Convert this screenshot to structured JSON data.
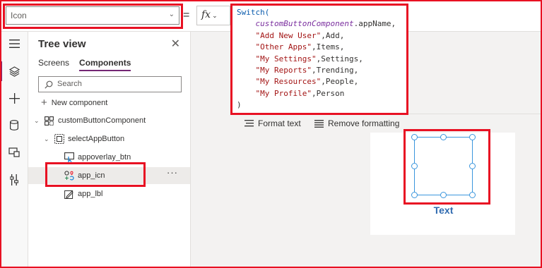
{
  "formula_bar": {
    "property": "Icon",
    "equals": "=",
    "fx": "fx",
    "formula_lines": [
      {
        "parts": [
          {
            "t": "Switch(",
            "c": "kw"
          }
        ]
      },
      {
        "parts": [
          {
            "t": "    ",
            "c": ""
          },
          {
            "t": "customButtonComponent",
            "c": "it"
          },
          {
            "t": ".appName,",
            "c": ""
          }
        ]
      },
      {
        "parts": [
          {
            "t": "    ",
            "c": ""
          },
          {
            "t": "\"Add New User\"",
            "c": "str"
          },
          {
            "t": ",Add,",
            "c": ""
          }
        ]
      },
      {
        "parts": [
          {
            "t": "    ",
            "c": ""
          },
          {
            "t": "\"Other Apps\"",
            "c": "str"
          },
          {
            "t": ",Items,",
            "c": ""
          }
        ]
      },
      {
        "parts": [
          {
            "t": "    ",
            "c": ""
          },
          {
            "t": "\"My Settings\"",
            "c": "str"
          },
          {
            "t": ",Settings,",
            "c": ""
          }
        ]
      },
      {
        "parts": [
          {
            "t": "    ",
            "c": ""
          },
          {
            "t": "\"My Reports\"",
            "c": "str"
          },
          {
            "t": ",Trending,",
            "c": ""
          }
        ]
      },
      {
        "parts": [
          {
            "t": "    ",
            "c": ""
          },
          {
            "t": "\"My Resources\"",
            "c": "str"
          },
          {
            "t": ",People,",
            "c": ""
          }
        ]
      },
      {
        "parts": [
          {
            "t": "    ",
            "c": ""
          },
          {
            "t": "\"My Profile\"",
            "c": "str"
          },
          {
            "t": ",Person",
            "c": ""
          }
        ]
      },
      {
        "parts": [
          {
            "t": ")",
            "c": ""
          }
        ]
      }
    ],
    "format_text": "Format text",
    "remove_formatting": "Remove formatting"
  },
  "tree_view": {
    "title": "Tree view",
    "tabs": [
      "Screens",
      "Components"
    ],
    "active_tab": "Components",
    "search_placeholder": "Search",
    "new_component": "New component",
    "nodes": {
      "component": "customButtonComponent",
      "group": "selectAppButton",
      "overlay": "appoverlay_btn",
      "icon": "app_icn",
      "label": "app_lbl"
    },
    "more": "···"
  },
  "canvas": {
    "text": "Text"
  },
  "colors": {
    "highlight": "#e81123",
    "accent": "#742774",
    "selection": "#3a96dd",
    "text_blue": "#2f6ab0"
  },
  "icons": [
    "hamburger-icon",
    "layers-icon",
    "plus-icon",
    "database-icon",
    "media-icon",
    "tools-icon",
    "search-icon",
    "close-icon"
  ]
}
